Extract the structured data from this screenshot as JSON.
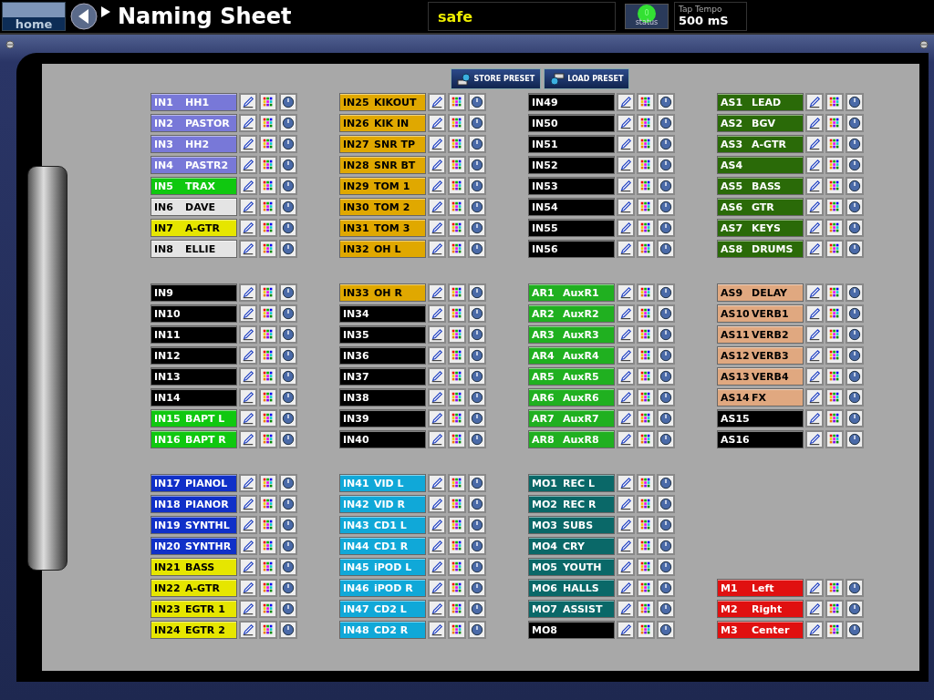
{
  "header": {
    "home": "home",
    "title": "Naming Sheet",
    "mode": "safe",
    "status": {
      "label": "status",
      "count": "0",
      "on": true
    },
    "tap_tempo": {
      "label": "Tap Tempo",
      "value": "500 mS"
    }
  },
  "toolbar": [
    {
      "kind": "store",
      "label": "STORE PRESET"
    },
    {
      "kind": "load",
      "label": "LOAD PRESET"
    }
  ],
  "columns": [
    {
      "blocks": [
        {
          "channels": [
            {
              "id": "IN1",
              "name": "HH1",
              "color": "#7878d8"
            },
            {
              "id": "IN2",
              "name": "PASTOR",
              "color": "#7878d8"
            },
            {
              "id": "IN3",
              "name": "HH2",
              "color": "#7878d8"
            },
            {
              "id": "IN4",
              "name": "PASTR2",
              "color": "#7878d8"
            },
            {
              "id": "IN5",
              "name": "TRAX",
              "color": "#10c810"
            },
            {
              "id": "IN6",
              "name": "DAVE",
              "color": "#e4e4e4"
            },
            {
              "id": "IN7",
              "name": "A-GTR",
              "color": "#e6e600"
            },
            {
              "id": "IN8",
              "name": "ELLIE",
              "color": "#e4e4e4"
            }
          ]
        },
        {
          "channels": [
            {
              "id": "IN9",
              "color": "#000000"
            },
            {
              "id": "IN10",
              "color": "#000000"
            },
            {
              "id": "IN11",
              "color": "#000000"
            },
            {
              "id": "IN12",
              "color": "#000000"
            },
            {
              "id": "IN13",
              "color": "#000000"
            },
            {
              "id": "IN14",
              "color": "#000000"
            },
            {
              "id": "IN15",
              "name": "BAPT L",
              "color": "#10c810"
            },
            {
              "id": "IN16",
              "name": "BAPT R",
              "color": "#10c810"
            }
          ]
        },
        {
          "channels": [
            {
              "id": "IN17",
              "name": "PIANOL",
              "color": "#1030c8"
            },
            {
              "id": "IN18",
              "name": "PIANOR",
              "color": "#1030c8"
            },
            {
              "id": "IN19",
              "name": "SYNTHL",
              "color": "#1030c8"
            },
            {
              "id": "IN20",
              "name": "SYNTHR",
              "color": "#1030c8"
            },
            {
              "id": "IN21",
              "name": "BASS",
              "color": "#e6e600"
            },
            {
              "id": "IN22",
              "name": "A-GTR",
              "color": "#e6e600"
            },
            {
              "id": "IN23",
              "name": "EGTR 1",
              "color": "#e6e600"
            },
            {
              "id": "IN24",
              "name": "EGTR 2",
              "color": "#e6e600"
            }
          ]
        }
      ]
    },
    {
      "blocks": [
        {
          "channels": [
            {
              "id": "IN25",
              "name": "KIKOUT",
              "color": "#e0a800"
            },
            {
              "id": "IN26",
              "name": "KIK IN",
              "color": "#e0a800"
            },
            {
              "id": "IN27",
              "name": "SNR TP",
              "color": "#e0a800"
            },
            {
              "id": "IN28",
              "name": "SNR BT",
              "color": "#e0a800"
            },
            {
              "id": "IN29",
              "name": "TOM 1",
              "color": "#e0a800"
            },
            {
              "id": "IN30",
              "name": "TOM 2",
              "color": "#e0a800"
            },
            {
              "id": "IN31",
              "name": "TOM 3",
              "color": "#e0a800"
            },
            {
              "id": "IN32",
              "name": "OH L",
              "color": "#e0a800"
            }
          ]
        },
        {
          "channels": [
            {
              "id": "IN33",
              "name": "OH R",
              "color": "#e0a800"
            },
            {
              "id": "IN34",
              "color": "#000000"
            },
            {
              "id": "IN35",
              "color": "#000000"
            },
            {
              "id": "IN36",
              "color": "#000000"
            },
            {
              "id": "IN37",
              "color": "#000000"
            },
            {
              "id": "IN38",
              "color": "#000000"
            },
            {
              "id": "IN39",
              "color": "#000000"
            },
            {
              "id": "IN40",
              "color": "#000000"
            }
          ]
        },
        {
          "channels": [
            {
              "id": "IN41",
              "name": "VID L",
              "color": "#10a8d8"
            },
            {
              "id": "IN42",
              "name": "VID R",
              "color": "#10a8d8"
            },
            {
              "id": "IN43",
              "name": "CD1 L",
              "color": "#10a8d8"
            },
            {
              "id": "IN44",
              "name": "CD1 R",
              "color": "#10a8d8"
            },
            {
              "id": "IN45",
              "name": "iPOD L",
              "color": "#10a8d8"
            },
            {
              "id": "IN46",
              "name": "iPOD R",
              "color": "#10a8d8"
            },
            {
              "id": "IN47",
              "name": "CD2 L",
              "color": "#10a8d8"
            },
            {
              "id": "IN48",
              "name": "CD2 R",
              "color": "#10a8d8"
            }
          ]
        }
      ]
    },
    {
      "blocks": [
        {
          "channels": [
            {
              "id": "IN49",
              "color": "#000000"
            },
            {
              "id": "IN50",
              "color": "#000000"
            },
            {
              "id": "IN51",
              "color": "#000000"
            },
            {
              "id": "IN52",
              "color": "#000000"
            },
            {
              "id": "IN53",
              "color": "#000000"
            },
            {
              "id": "IN54",
              "color": "#000000"
            },
            {
              "id": "IN55",
              "color": "#000000"
            },
            {
              "id": "IN56",
              "color": "#000000"
            }
          ]
        },
        {
          "channels": [
            {
              "id": "AR1",
              "name": "AuxR1",
              "color": "#20b020"
            },
            {
              "id": "AR2",
              "name": "AuxR2",
              "color": "#20b020"
            },
            {
              "id": "AR3",
              "name": "AuxR3",
              "color": "#20b020"
            },
            {
              "id": "AR4",
              "name": "AuxR4",
              "color": "#20b020"
            },
            {
              "id": "AR5",
              "name": "AuxR5",
              "color": "#20b020"
            },
            {
              "id": "AR6",
              "name": "AuxR6",
              "color": "#20b020"
            },
            {
              "id": "AR7",
              "name": "AuxR7",
              "color": "#20b020"
            },
            {
              "id": "AR8",
              "name": "AuxR8",
              "color": "#20b020"
            }
          ]
        },
        {
          "channels": [
            {
              "id": "MO1",
              "name": "REC L",
              "color": "#0a6868"
            },
            {
              "id": "MO2",
              "name": "REC R",
              "color": "#0a6868"
            },
            {
              "id": "MO3",
              "name": "SUBS",
              "color": "#0a6868"
            },
            {
              "id": "MO4",
              "name": "CRY",
              "color": "#0a6868"
            },
            {
              "id": "MO5",
              "name": "YOUTH",
              "color": "#0a6868"
            },
            {
              "id": "MO6",
              "name": "HALLS",
              "color": "#0a6868"
            },
            {
              "id": "MO7",
              "name": "ASSIST",
              "color": "#0a6868"
            },
            {
              "id": "MO8",
              "color": "#000000"
            }
          ]
        }
      ]
    },
    {
      "blocks": [
        {
          "channels": [
            {
              "id": "AS1",
              "name": "LEAD",
              "color": "#2a6a08"
            },
            {
              "id": "AS2",
              "name": "BGV",
              "color": "#2a6a08"
            },
            {
              "id": "AS3",
              "name": "A-GTR",
              "color": "#2a6a08"
            },
            {
              "id": "AS4",
              "color": "#2a6a08"
            },
            {
              "id": "AS5",
              "name": "BASS",
              "color": "#2a6a08"
            },
            {
              "id": "AS6",
              "name": "GTR",
              "color": "#2a6a08"
            },
            {
              "id": "AS7",
              "name": "KEYS",
              "color": "#2a6a08"
            },
            {
              "id": "AS8",
              "name": "DRUMS",
              "color": "#2a6a08"
            }
          ]
        },
        {
          "channels": [
            {
              "id": "AS9",
              "name": "DELAY",
              "color": "#e0a880"
            },
            {
              "id": "AS10",
              "name": "VERB1",
              "color": "#e0a880"
            },
            {
              "id": "AS11",
              "name": "VERB2",
              "color": "#e0a880"
            },
            {
              "id": "AS12",
              "name": "VERB3",
              "color": "#e0a880"
            },
            {
              "id": "AS13",
              "name": "VERB4",
              "color": "#e0a880"
            },
            {
              "id": "AS14",
              "name": "FX",
              "color": "#e0a880"
            },
            {
              "id": "AS15",
              "color": "#000000"
            },
            {
              "id": "AS16",
              "color": "#000000"
            }
          ]
        },
        {
          "bottom_aligned": true,
          "channels": [
            {
              "id": "M1",
              "name": "Left",
              "color": "#e01010"
            },
            {
              "id": "M2",
              "name": "Right",
              "color": "#e01010"
            },
            {
              "id": "M3",
              "name": "Center",
              "color": "#e01010"
            }
          ]
        }
      ]
    }
  ]
}
